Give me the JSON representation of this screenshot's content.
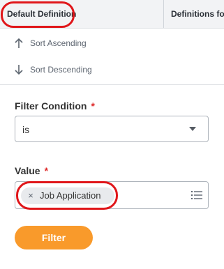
{
  "header": {
    "columns": [
      {
        "label": "Default Definition"
      },
      {
        "label": "Definitions for"
      }
    ]
  },
  "sort_menu": {
    "ascending": {
      "label": "Sort Ascending",
      "icon": "arrow-up-icon"
    },
    "descending": {
      "label": "Sort Descending",
      "icon": "arrow-down-icon"
    }
  },
  "filter": {
    "condition_label": "Filter Condition",
    "condition_required": "*",
    "condition_value": "is",
    "value_label": "Value",
    "value_required": "*",
    "value_tokens": [
      {
        "label": "Job Application",
        "remove_icon": "×"
      }
    ],
    "prompt_icon": "list-icon",
    "button_label": "Filter"
  },
  "colors": {
    "accent": "#f99a2b",
    "required": "#de2b2b",
    "highlight": "#e0161a"
  }
}
